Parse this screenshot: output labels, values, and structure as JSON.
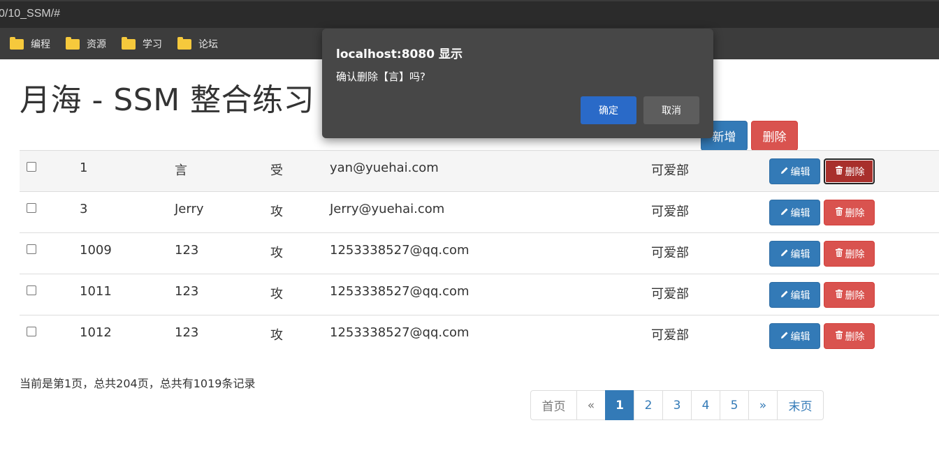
{
  "browser": {
    "url": "0/10_SSM/#",
    "bookmarks": [
      {
        "label": "编程"
      },
      {
        "label": "资源"
      },
      {
        "label": "学习"
      },
      {
        "label": "论坛"
      }
    ]
  },
  "header": {
    "title": "月海 - SSM 整合练习",
    "add_label": "新增",
    "delete_label": "删除"
  },
  "table": {
    "edit_label": "编辑",
    "delete_label": "删除",
    "rows": [
      {
        "id": "1",
        "name": "言",
        "gender": "受",
        "email": "yan@yuehai.com",
        "dept": "可爱部"
      },
      {
        "id": "3",
        "name": "Jerry",
        "gender": "攻",
        "email": "Jerry@yuehai.com",
        "dept": "可爱部"
      },
      {
        "id": "1009",
        "name": "123",
        "gender": "攻",
        "email": "1253338527@qq.com",
        "dept": "可爱部"
      },
      {
        "id": "1011",
        "name": "123",
        "gender": "攻",
        "email": "1253338527@qq.com",
        "dept": "可爱部"
      },
      {
        "id": "1012",
        "name": "123",
        "gender": "攻",
        "email": "1253338527@qq.com",
        "dept": "可爱部"
      }
    ]
  },
  "pagination": {
    "info": "当前是第1页，总共204页，总共有1019条记录",
    "first": "首页",
    "prev": "«",
    "pages": [
      "1",
      "2",
      "3",
      "4",
      "5"
    ],
    "current": "1",
    "next": "»",
    "last": "末页"
  },
  "dialog": {
    "title": "localhost:8080 显示",
    "message": "确认删除【言】吗?",
    "ok_label": "确定",
    "cancel_label": "取消"
  },
  "colors": {
    "primary": "#337ab7",
    "danger": "#d9534f",
    "dialog_bg": "#474747",
    "dialog_ok": "#2a6ac8"
  }
}
